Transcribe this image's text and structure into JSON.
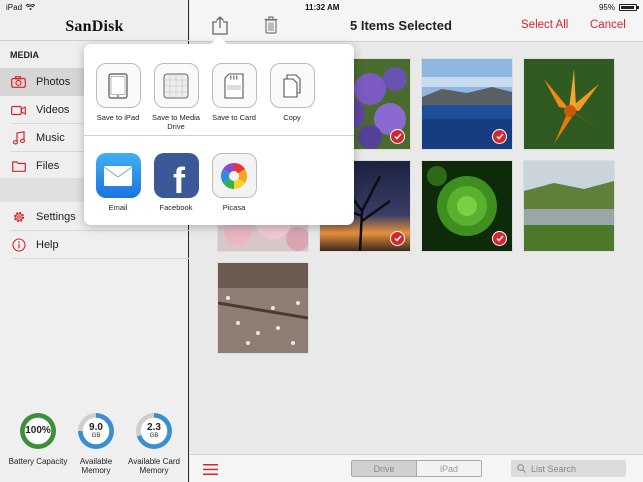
{
  "status_bar": {
    "device": "iPad",
    "time": "11:32 AM",
    "battery": "95%",
    "battery_level": 0.95
  },
  "sidebar": {
    "logo": "SanDisk",
    "section": "MEDIA",
    "media_items": [
      {
        "label": "Photos",
        "icon": "camera-icon",
        "active": true
      },
      {
        "label": "Videos",
        "icon": "video-camera-icon"
      },
      {
        "label": "Music",
        "icon": "music-note-icon"
      },
      {
        "label": "Files",
        "icon": "folder-icon"
      }
    ],
    "other_items": [
      {
        "label": "Settings",
        "icon": "gear-icon"
      },
      {
        "label": "Help",
        "icon": "info-icon"
      }
    ],
    "gauges": [
      {
        "value": "100%",
        "unit": "",
        "label": "Battery Capacity",
        "fraction": 1.0,
        "color": "#3e8f3a"
      },
      {
        "value": "9.0",
        "unit": "GB",
        "label": "Available Memory",
        "fraction": 0.75,
        "color": "#3a8fd1"
      },
      {
        "value": "2.3",
        "unit": "GB",
        "label": "Available Card Memory",
        "fraction": 0.7,
        "color": "#3a8fd1"
      }
    ]
  },
  "toolbar": {
    "title": "5 Items Selected",
    "select_all": "Select All",
    "cancel": "Cancel",
    "accent": "#d8242c"
  },
  "share": {
    "actions": [
      {
        "label": "Save to iPad",
        "icon": "ipad-icon"
      },
      {
        "label": "Save to Media Drive",
        "icon": "media-drive-icon"
      },
      {
        "label": "Save to Card",
        "icon": "sd-card-icon"
      },
      {
        "label": "Copy",
        "icon": "copy-icon"
      }
    ],
    "apps": [
      {
        "label": "Email",
        "icon": "mail-icon"
      },
      {
        "label": "Facebook",
        "icon": "facebook-icon"
      },
      {
        "label": "Picasa",
        "icon": "picasa-icon"
      }
    ]
  },
  "photos": [
    {
      "name": "purple-flowers",
      "selected": true
    },
    {
      "name": "crater-lake",
      "selected": true
    },
    {
      "name": "orange-lily",
      "selected": false
    },
    {
      "name": "cherry-blossoms",
      "selected": false
    },
    {
      "name": "sunset-tree",
      "selected": true
    },
    {
      "name": "green-succulent",
      "selected": true
    },
    {
      "name": "hillside-pond",
      "selected": false
    },
    {
      "name": "petals-on-ground",
      "selected": false
    }
  ],
  "bottom_bar": {
    "segment": [
      "Drive",
      "iPad"
    ],
    "search_placeholder": "List Search"
  }
}
